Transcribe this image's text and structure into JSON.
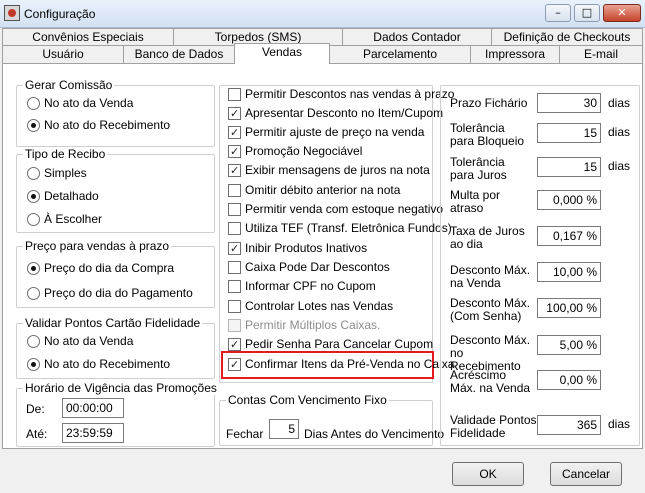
{
  "window": {
    "title": "Configuração",
    "minimize": "–",
    "maximize": "□",
    "close": "✕"
  },
  "tabs_row1": [
    "Convênios Especiais",
    "Torpedos (SMS)",
    "Dados Contador",
    "Definição de Checkouts"
  ],
  "tabs_row2": [
    "Usuário",
    "Banco de Dados",
    "Vendas",
    "Parcelamento",
    "Impressora",
    "E-mail"
  ],
  "active_tab": "Vendas",
  "gerar_comissao": {
    "label": "Gerar Comissão",
    "opt1": "No ato da Venda",
    "opt2": "No ato do Recebimento",
    "selected": 2
  },
  "tipo_recibo": {
    "label": "Tipo de Recibo",
    "opt1": "Simples",
    "opt2": "Detalhado",
    "opt3": "À Escolher",
    "selected": 2
  },
  "preco_prazo": {
    "label": "Preço para vendas à prazo",
    "opt1": "Preço do dia da Compra",
    "opt2": "Preço do dia do Pagamento",
    "selected": 1
  },
  "pontos": {
    "label": "Validar Pontos Cartão Fidelidade",
    "opt1": "No ato da Venda",
    "opt2": "No ato do Recebimento",
    "selected": 2
  },
  "horario": {
    "label": "Horário de Vigência das Promoções",
    "de_label": "De:",
    "de_value": "00:00:00",
    "ate_label": "Até:",
    "ate_value": "23:59:59"
  },
  "checkboxes": [
    {
      "label": "Permitir Descontos nas vendas à prazo",
      "checked": false,
      "disabled": false
    },
    {
      "label": "Apresentar Desconto no Item/Cupom",
      "checked": true,
      "disabled": false
    },
    {
      "label": "Permitir ajuste de preço na venda",
      "checked": true,
      "disabled": false
    },
    {
      "label": "Promoção Negociável",
      "checked": true,
      "disabled": false
    },
    {
      "label": "Exibir mensagens de juros na nota",
      "checked": true,
      "disabled": false
    },
    {
      "label": "Omitir débito anterior na nota",
      "checked": false,
      "disabled": false
    },
    {
      "label": "Permitir venda com estoque negativo",
      "checked": false,
      "disabled": false
    },
    {
      "label": "Utiliza TEF (Transf. Eletrônica Fundos)",
      "checked": false,
      "disabled": false
    },
    {
      "label": "Inibir Produtos Inativos",
      "checked": true,
      "disabled": false
    },
    {
      "label": "Caixa Pode Dar Descontos",
      "checked": false,
      "disabled": false
    },
    {
      "label": "Informar CPF no Cupom",
      "checked": false,
      "disabled": false
    },
    {
      "label": "Controlar Lotes nas Vendas",
      "checked": false,
      "disabled": false
    },
    {
      "label": "Permitir Múltiplos Caixas.",
      "checked": false,
      "disabled": true
    },
    {
      "label": "Pedir Senha Para Cancelar Cupom",
      "checked": true,
      "disabled": false
    },
    {
      "label": "Confirmar Itens da Pré-Venda no Caixa",
      "checked": true,
      "disabled": false
    }
  ],
  "contas": {
    "label": "Contas Com Vencimento Fixo",
    "fechar": "Fechar",
    "value": "5",
    "suffix": "Dias Antes do Vencimento"
  },
  "fields": [
    {
      "label": "Prazo Fichário",
      "value": "30",
      "unit": "dias"
    },
    {
      "label": "Tolerância para Bloqueio",
      "value": "15",
      "unit": "dias"
    },
    {
      "label": "Tolerância para Juros",
      "value": "15",
      "unit": "dias"
    },
    {
      "label": "Multa por atraso",
      "value": "0,000 %",
      "unit": ""
    },
    {
      "label": "Taxa de Juros ao dia",
      "value": "0,167 %",
      "unit": ""
    },
    {
      "label": "Desconto Máx. na Venda",
      "value": "10,00 %",
      "unit": ""
    },
    {
      "label": "Desconto Máx. (Com Senha)",
      "value": "100,00 %",
      "unit": ""
    },
    {
      "label": "Desconto Máx. no Recebimento",
      "value": "5,00 %",
      "unit": ""
    },
    {
      "label": "Acréscimo Máx. na Venda",
      "value": "0,00 %",
      "unit": ""
    },
    {
      "label": "Validade Pontos Fidelidade",
      "value": "365",
      "unit": "dias"
    }
  ],
  "buttons": {
    "ok": "OK",
    "cancel": "Cancelar"
  },
  "colors": {
    "highlight": "#e21a1a",
    "close": "#c7432b"
  }
}
